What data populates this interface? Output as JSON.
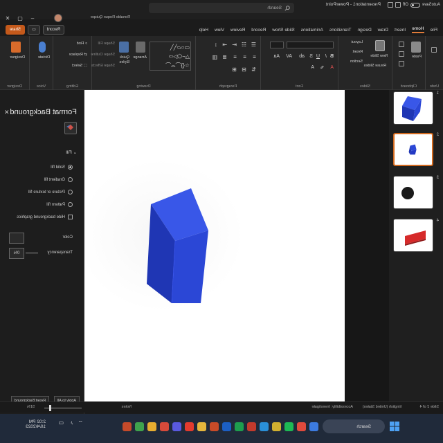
{
  "window": {
    "autosave_label": "AutoSave",
    "autosave_state": "Off",
    "title": "Presentation1 - PowerPoint",
    "search_placeholder": "Search",
    "user": "Ronaldo Roque Quispe"
  },
  "tabs": [
    "File",
    "Home",
    "Insert",
    "Draw",
    "Design",
    "Transitions",
    "Animations",
    "Slide Show",
    "Record",
    "Review",
    "View",
    "Help"
  ],
  "active_tab": "Home",
  "header_buttons": {
    "record": "Record",
    "share": "Share"
  },
  "ribbon": {
    "groups": [
      "Undo",
      "Clipboard",
      "Slides",
      "Font",
      "Paragraph",
      "Drawing",
      "Editing",
      "Voice",
      "Designer"
    ],
    "clipboard": {
      "paste": "Paste"
    },
    "slides": {
      "new_slide": "New Slide",
      "layout": "Layout",
      "reset": "Reset",
      "section": "Section",
      "reuse": "Reuse Slides"
    },
    "drawing": {
      "arrange": "Arrange",
      "quick_styles": "Quick Styles",
      "shape_fill": "Shape Fill",
      "shape_outline": "Shape Outline",
      "shape_effects": "Shape Effects"
    },
    "editing": {
      "find": "Find",
      "replace": "Replace",
      "select": "Select"
    },
    "voice": {
      "dictate": "Dictate"
    },
    "designer": {
      "designer": "Designer"
    }
  },
  "slides": [
    {
      "number": "1",
      "shape": "cube"
    },
    {
      "number": "2",
      "shape": "cube-small"
    },
    {
      "number": "3",
      "shape": "sphere"
    },
    {
      "number": "4",
      "shape": "wedge"
    }
  ],
  "active_slide": 2,
  "format_pane": {
    "title": "Format Background",
    "fill_heading": "Fill",
    "options": [
      "Solid fill",
      "Gradient fill",
      "Picture or texture fill",
      "Pattern fill",
      "Hide background graphics"
    ],
    "selected_option": "Solid fill",
    "color_label": "Color",
    "transparency_label": "Transparency",
    "transparency_value": "0%",
    "apply_all": "Apply to All",
    "reset": "Reset Background"
  },
  "statusbar": {
    "slide_info": "Slide 2 of 4",
    "language": "English (United States)",
    "accessibility": "Accessibility: Investigate",
    "notes": "Notes",
    "zoom": "51%"
  },
  "taskbar": {
    "search_placeholder": "Search",
    "time": "2:02 PM",
    "date": "10/4/2023"
  },
  "colors": {
    "accent": "#c4591b",
    "cube_front": "#2b47d6",
    "cube_top": "#3957e8",
    "cube_side": "#1f36b4",
    "red_shape": "#d62a2a"
  }
}
